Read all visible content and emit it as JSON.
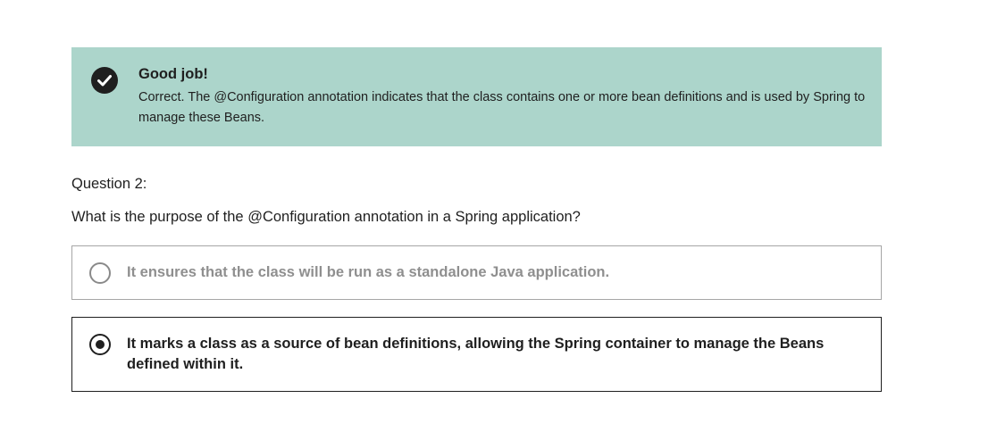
{
  "feedback": {
    "icon": "check-circle-icon",
    "background_color": "#acd5cb",
    "title": "Good job!",
    "message": "Correct. The @Configuration annotation indicates that the class contains one or more bean definitions and is used by Spring to manage these Beans."
  },
  "question": {
    "number_label": "Question 2:",
    "text": "What is the purpose of the @Configuration annotation in a Spring application?",
    "options": [
      {
        "label": "It ensures that the class will be run as a standalone Java application.",
        "selected": false
      },
      {
        "label": "It marks a class as a source of bean definitions, allowing the Spring container to manage the Beans defined within it.",
        "selected": true
      }
    ]
  }
}
